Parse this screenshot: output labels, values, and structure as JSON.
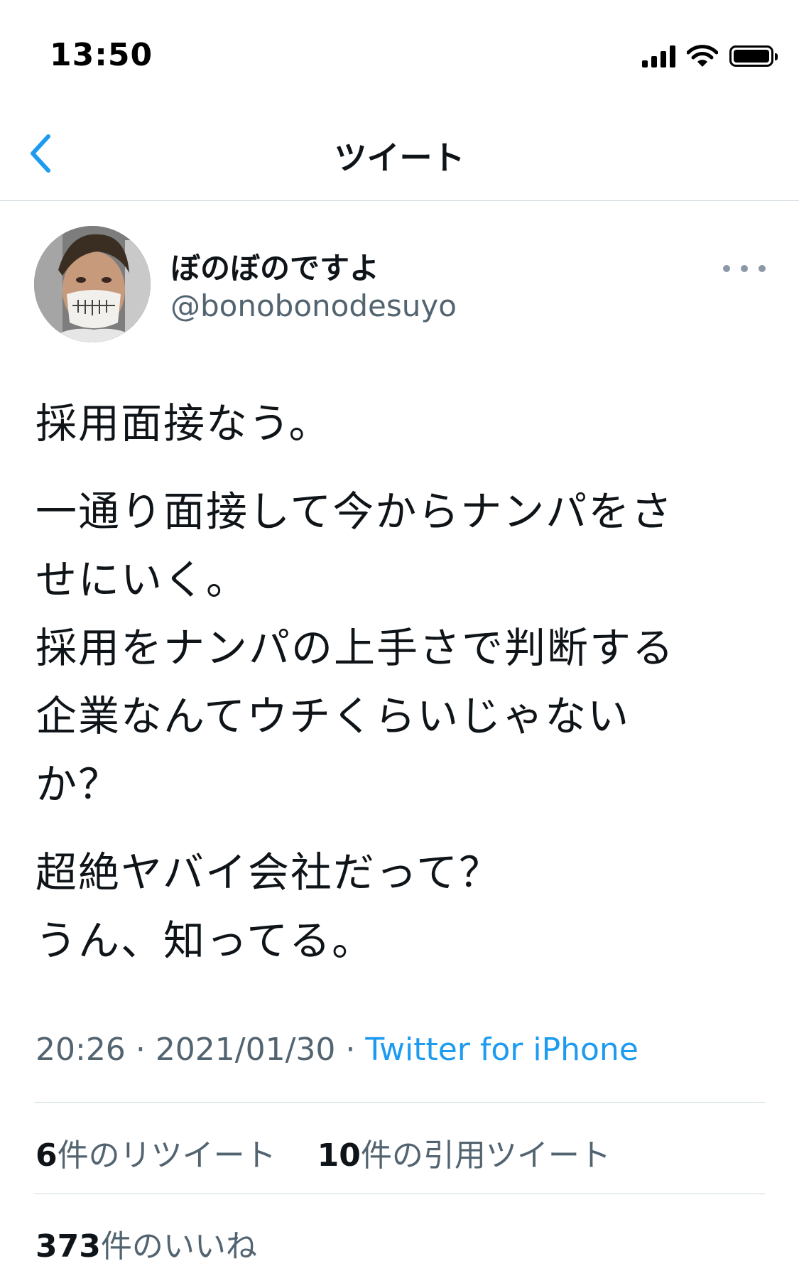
{
  "status_bar": {
    "time": "13:50"
  },
  "nav": {
    "title": "ツイート"
  },
  "tweet": {
    "display_name": "ぼのぼのですよ",
    "handle": "@bonobonodesuyo",
    "paragraphs": [
      [
        "採用面接なう。"
      ],
      [
        "一通り面接して今からナンパをさ",
        "せにいく。",
        "採用をナンパの上手さで判断する",
        "企業なんてウチくらいじゃない",
        "か？"
      ],
      [
        "超絶ヤバイ会社だって？",
        "うん、知ってる。"
      ]
    ],
    "time": "20:26",
    "date": "2021/01/30",
    "separator": "·",
    "source": "Twitter for iPhone",
    "retweets": {
      "count": "6",
      "label": "件のリツイート"
    },
    "quotes": {
      "count": "10",
      "label": "件の引用ツイート"
    },
    "likes": {
      "count": "373",
      "label": "件のいいね"
    }
  },
  "colors": {
    "link": "#1d9bf0",
    "secondary_text": "#536471",
    "divider": "#cfd9de"
  }
}
